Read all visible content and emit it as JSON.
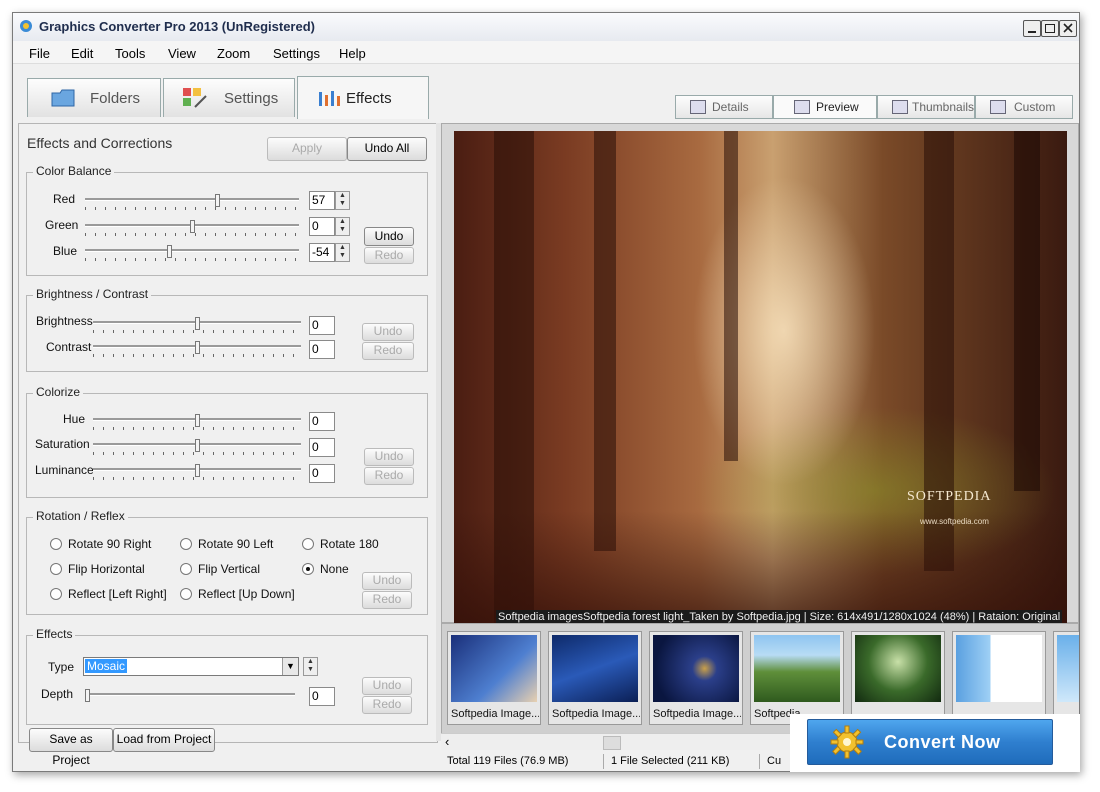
{
  "window": {
    "title": "Graphics Converter Pro 2013  (UnRegistered)"
  },
  "menu": [
    "File",
    "Edit",
    "Tools",
    "View",
    "Zoom",
    "Settings",
    "Help"
  ],
  "main_tabs": [
    {
      "label": "Folders",
      "icon": "folder-icon"
    },
    {
      "label": "Settings",
      "icon": "settings-icon"
    },
    {
      "label": "Effects",
      "icon": "effects-icon",
      "active": true
    }
  ],
  "view_tabs": [
    {
      "label": "Details"
    },
    {
      "label": "Preview",
      "active": true
    },
    {
      "label": "Thumbnails"
    },
    {
      "label": "Custom"
    }
  ],
  "effects_panel": {
    "title": "Effects and Corrections",
    "apply_label": "Apply",
    "undo_all_label": "Undo All",
    "color_balance": {
      "title": "Color Balance",
      "rows": [
        {
          "label": "Red",
          "value": "57",
          "level": 0.62
        },
        {
          "label": "Green",
          "value": "0",
          "level": 0.5
        },
        {
          "label": "Blue",
          "value": "-54",
          "level": 0.39
        }
      ],
      "undo_label": "Undo",
      "redo_label": "Redo"
    },
    "brightness_contrast": {
      "title": "Brightness / Contrast",
      "rows": [
        {
          "label": "Brightness",
          "value": "0",
          "level": 0.5
        },
        {
          "label": "Contrast",
          "value": "0",
          "level": 0.5
        }
      ],
      "undo_label": "Undo",
      "redo_label": "Redo"
    },
    "colorize": {
      "title": "Colorize",
      "rows": [
        {
          "label": "Hue",
          "value": "0",
          "level": 0.5
        },
        {
          "label": "Saturation",
          "value": "0",
          "level": 0.5
        },
        {
          "label": "Luminance",
          "value": "0",
          "level": 0.5
        }
      ],
      "undo_label": "Undo",
      "redo_label": "Redo"
    },
    "rotation": {
      "title": "Rotation / Reflex",
      "options": [
        {
          "label": "Rotate 90 Right",
          "checked": false
        },
        {
          "label": "Rotate 90 Left",
          "checked": false
        },
        {
          "label": "Rotate 180",
          "checked": false
        },
        {
          "label": "Flip Horizontal",
          "checked": false
        },
        {
          "label": "Flip Vertical",
          "checked": false
        },
        {
          "label": "None",
          "checked": true
        },
        {
          "label": "Reflect [Left Right]",
          "checked": false
        },
        {
          "label": "Reflect [Up Down]",
          "checked": false
        }
      ],
      "undo_label": "Undo",
      "redo_label": "Redo"
    },
    "effects": {
      "title": "Effects",
      "type_label": "Type",
      "type_value": "Mosaic",
      "depth_label": "Depth",
      "depth_value": "0",
      "undo_label": "Undo",
      "redo_label": "Redo"
    },
    "save_project_label": "Save as Project",
    "load_project_label": "Load from Project"
  },
  "preview": {
    "caption": "Softpedia imagesSoftpedia forest light_Taken by Softpedia.jpg  |  Size: 614x491/1280x1024 (48%)  |  Rataion: Original",
    "watermark": "SOFTPEDIA",
    "watermark_sub": "www.softpedia.com"
  },
  "thumbnails": [
    {
      "caption": "Softpedia Image..."
    },
    {
      "caption": "Softpedia Image..."
    },
    {
      "caption": "Softpedia Image..."
    },
    {
      "caption": "Softpedia"
    },
    {
      "caption": ""
    },
    {
      "caption": ""
    }
  ],
  "status": {
    "total": "Total 119 Files (76.9 MB)",
    "selected": "1 File Selected (211 KB)",
    "current": "Cu"
  },
  "convert": {
    "label": "Convert Now"
  }
}
